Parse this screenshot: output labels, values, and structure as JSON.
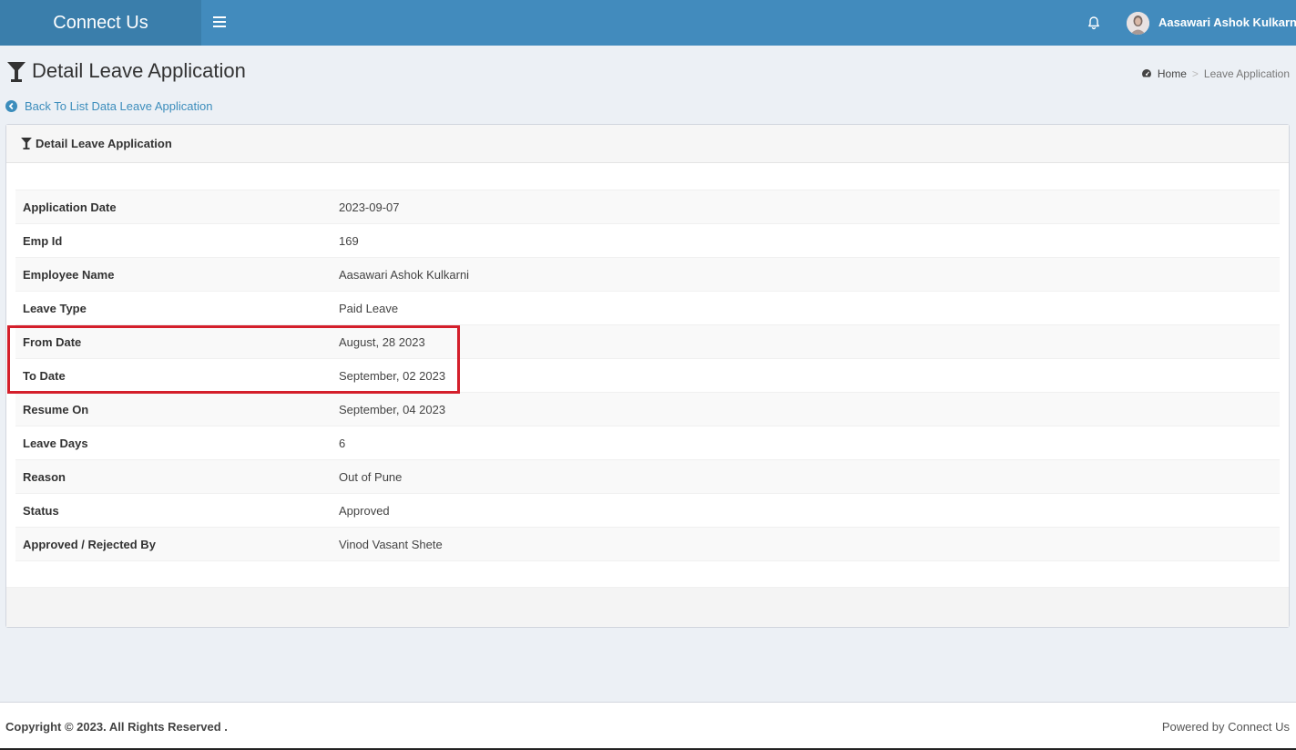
{
  "header": {
    "brand": "Connect Us",
    "user_name": "Aasawari Ashok Kulkarni"
  },
  "page": {
    "title": "Detail Leave Application",
    "back_link": "Back To List Data Leave Application"
  },
  "breadcrumb": {
    "home": "Home",
    "separator": ">",
    "current": "Leave Application"
  },
  "box": {
    "title": "Detail Leave Application"
  },
  "details": [
    {
      "label": "Application Date",
      "value": "2023-09-07"
    },
    {
      "label": "Emp Id",
      "value": "169"
    },
    {
      "label": "Employee Name",
      "value": "Aasawari Ashok Kulkarni"
    },
    {
      "label": "Leave Type",
      "value": "Paid Leave"
    },
    {
      "label": "From Date",
      "value": "August, 28 2023"
    },
    {
      "label": "To Date",
      "value": "September, 02 2023"
    },
    {
      "label": "Resume On",
      "value": "September, 04 2023"
    },
    {
      "label": "Leave Days",
      "value": "6"
    },
    {
      "label": "Reason",
      "value": "Out of Pune"
    },
    {
      "label": "Status",
      "value": "Approved"
    },
    {
      "label": "Approved / Rejected By",
      "value": "Vinod Vasant Shete"
    }
  ],
  "footer": {
    "copyright": "Copyright © 2023. All Rights Reserved .",
    "powered": "Powered by Connect Us"
  },
  "colors": {
    "header": "#428bbd",
    "brand_bg": "#3a7eab",
    "highlight": "#d41f2b",
    "link": "#3c8dbc"
  },
  "icons": {
    "menu": "hamburger-icon",
    "notifications": "bell-icon",
    "title": "filter-icon",
    "breadcrumb_home": "dashboard-icon",
    "back": "chevron-circle-left-icon"
  }
}
